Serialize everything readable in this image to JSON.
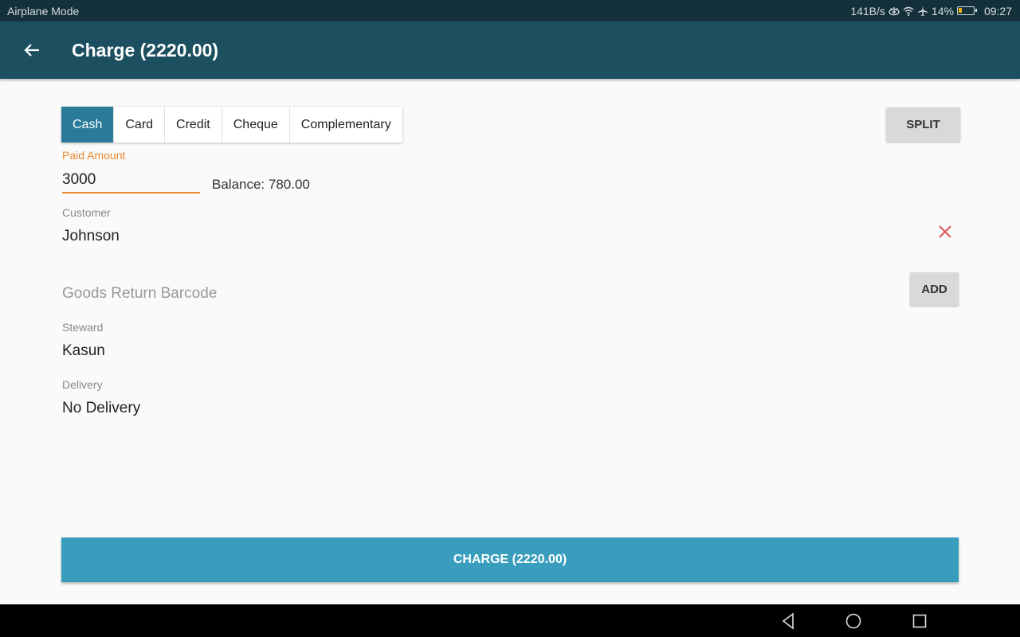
{
  "status_bar": {
    "left_text": "Airplane Mode",
    "net_speed": "141B/s",
    "battery_percent": "14%",
    "time": "09:27",
    "icons": [
      "eye-comfort-icon",
      "wifi-icon",
      "airplane-icon",
      "battery-icon"
    ]
  },
  "app_bar": {
    "back_icon": "arrow-left-icon",
    "title": "Charge (2220.00)"
  },
  "payment_tabs": [
    {
      "label": "Cash",
      "active": true
    },
    {
      "label": "Card",
      "active": false
    },
    {
      "label": "Credit",
      "active": false
    },
    {
      "label": "Cheque",
      "active": false
    },
    {
      "label": "Complementary",
      "active": false
    }
  ],
  "split_button": "SPLIT",
  "paid_amount": {
    "label": "Paid Amount",
    "value": "3000"
  },
  "balance": "Balance: 780.00",
  "customer": {
    "label": "Customer",
    "value": "Johnson",
    "clear_icon": "close-icon"
  },
  "goods_return": {
    "placeholder": "Goods Return Barcode",
    "value": "",
    "add_button": "ADD"
  },
  "steward": {
    "label": "Steward",
    "value": "Kasun"
  },
  "delivery": {
    "label": "Delivery",
    "value": "No Delivery"
  },
  "charge_button": "CHARGE (2220.00)",
  "colors": {
    "app_bar": "#1c4f5f",
    "active_tab": "#2a7b99",
    "accent": "#e8892e",
    "charge_button": "#399dbd",
    "clear_icon": "#e05a5a"
  },
  "nav_bar": {
    "icons": [
      "back-triangle-icon",
      "home-circle-icon",
      "recents-square-icon"
    ]
  }
}
